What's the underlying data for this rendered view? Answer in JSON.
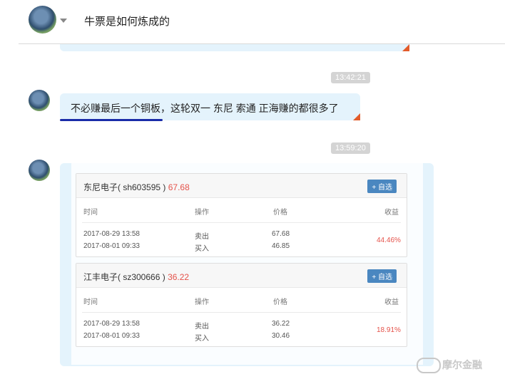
{
  "header": {
    "title": "牛票是如何炼成的"
  },
  "messages": [
    {
      "time": "13:42:21",
      "text": "不必赚最后一个铜板，这轮双一 东尼 索通 正海赚的都很多了"
    },
    {
      "time": "13:59:20"
    }
  ],
  "cards": [
    {
      "name": "东尼电子( sh603595 )",
      "price": "67.68",
      "add_label": "+ 自选",
      "columns": {
        "time": "时间",
        "action": "操作",
        "price": "价格",
        "yield": "收益"
      },
      "rows": [
        {
          "time": "2017-08-29 13:58",
          "action": "卖出",
          "price": "67.68"
        },
        {
          "time": "2017-08-01 09:33",
          "action": "买入",
          "price": "46.85"
        }
      ],
      "yield": "44.46%"
    },
    {
      "name": "江丰电子( sz300666 )",
      "price": "36.22",
      "add_label": "+ 自选",
      "columns": {
        "time": "时间",
        "action": "操作",
        "price": "价格",
        "yield": "收益"
      },
      "rows": [
        {
          "time": "2017-08-29 13:58",
          "action": "卖出",
          "price": "36.22"
        },
        {
          "time": "2017-08-01 09:33",
          "action": "买入",
          "price": "30.46"
        }
      ],
      "yield": "18.91%"
    }
  ],
  "watermark": {
    "text": "摩尔金融"
  },
  "colors": {
    "bubble": "#e4f3fc",
    "accent_red": "#e5534b",
    "button_blue": "#4a87c0",
    "underline": "#1a2ca8"
  }
}
